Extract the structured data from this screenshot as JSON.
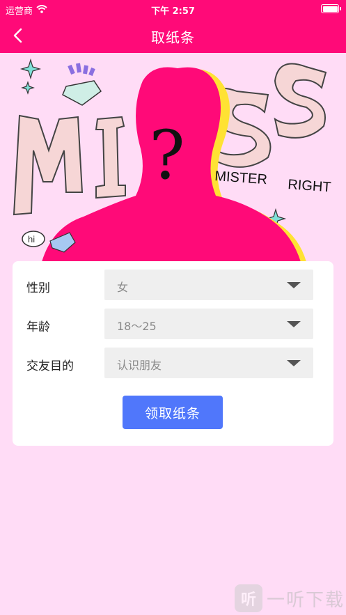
{
  "status_bar": {
    "carrier": "运营商",
    "time": "下午 2:57"
  },
  "nav": {
    "title": "取纸条"
  },
  "banner": {
    "big_letters": "MISS",
    "question_mark": "?",
    "line1": "MISTER",
    "line2": "RIGHT",
    "bubble": "hi"
  },
  "form": {
    "rows": [
      {
        "label": "性别",
        "value": "女"
      },
      {
        "label": "年龄",
        "value": "18～25"
      },
      {
        "label": "交友目的",
        "value": "认识朋友"
      }
    ],
    "submit_label": "领取纸条"
  },
  "watermark": {
    "logo_char": "听",
    "text": "一听下载"
  },
  "colors": {
    "primary_pink": "#ff0a78",
    "background": "#ffdcf6",
    "button_blue": "#5077fb"
  }
}
